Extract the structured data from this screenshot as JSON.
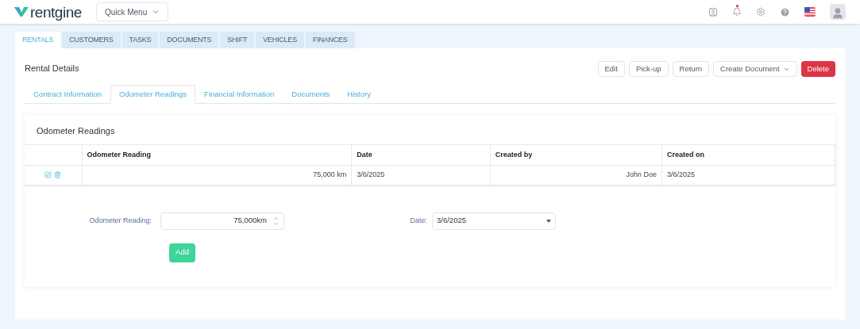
{
  "header": {
    "logo": "rentgine",
    "quick_menu": "Quick Menu",
    "has_notification": true
  },
  "main_tabs": [
    {
      "label": "RENTALS",
      "selected": true
    },
    {
      "label": "CUSTOMERS",
      "selected": false
    },
    {
      "label": "TASKS",
      "selected": false
    },
    {
      "label": "DOCUMENTS",
      "selected": false
    },
    {
      "label": "SHIFT",
      "selected": false
    },
    {
      "label": "VEHICLES",
      "selected": false
    },
    {
      "label": "FINANCES",
      "selected": false
    }
  ],
  "page_title": "Rental Details",
  "actions": [
    {
      "label": "Edit",
      "kind": "default",
      "has_caret": false
    },
    {
      "label": "Pick-up",
      "kind": "default",
      "has_caret": false
    },
    {
      "label": "Return",
      "kind": "default",
      "has_caret": false
    },
    {
      "label": "Create Document",
      "kind": "default",
      "has_caret": true
    },
    {
      "label": "Delete",
      "kind": "danger",
      "has_caret": false
    }
  ],
  "sub_tabs": [
    {
      "label": "Contract Information",
      "selected": false
    },
    {
      "label": "Odometer Readings",
      "selected": true
    },
    {
      "label": "Financial Information",
      "selected": false
    },
    {
      "label": "Documents",
      "selected": false
    },
    {
      "label": "History",
      "selected": false
    }
  ],
  "card_title": "Odometer Readings",
  "table": {
    "columns": [
      "Odometer Reading",
      "Date",
      "Created by",
      "Created on"
    ],
    "rows": [
      {
        "cells": [
          "75,000 km",
          "3/6/2025",
          "John Doe",
          "3/6/2025"
        ]
      }
    ]
  },
  "form": {
    "reading_label": "Odometer Reading:",
    "reading_value": "75,000km",
    "date_label": "Date:",
    "date_value": "3/6/2025",
    "add_button": "Add"
  }
}
